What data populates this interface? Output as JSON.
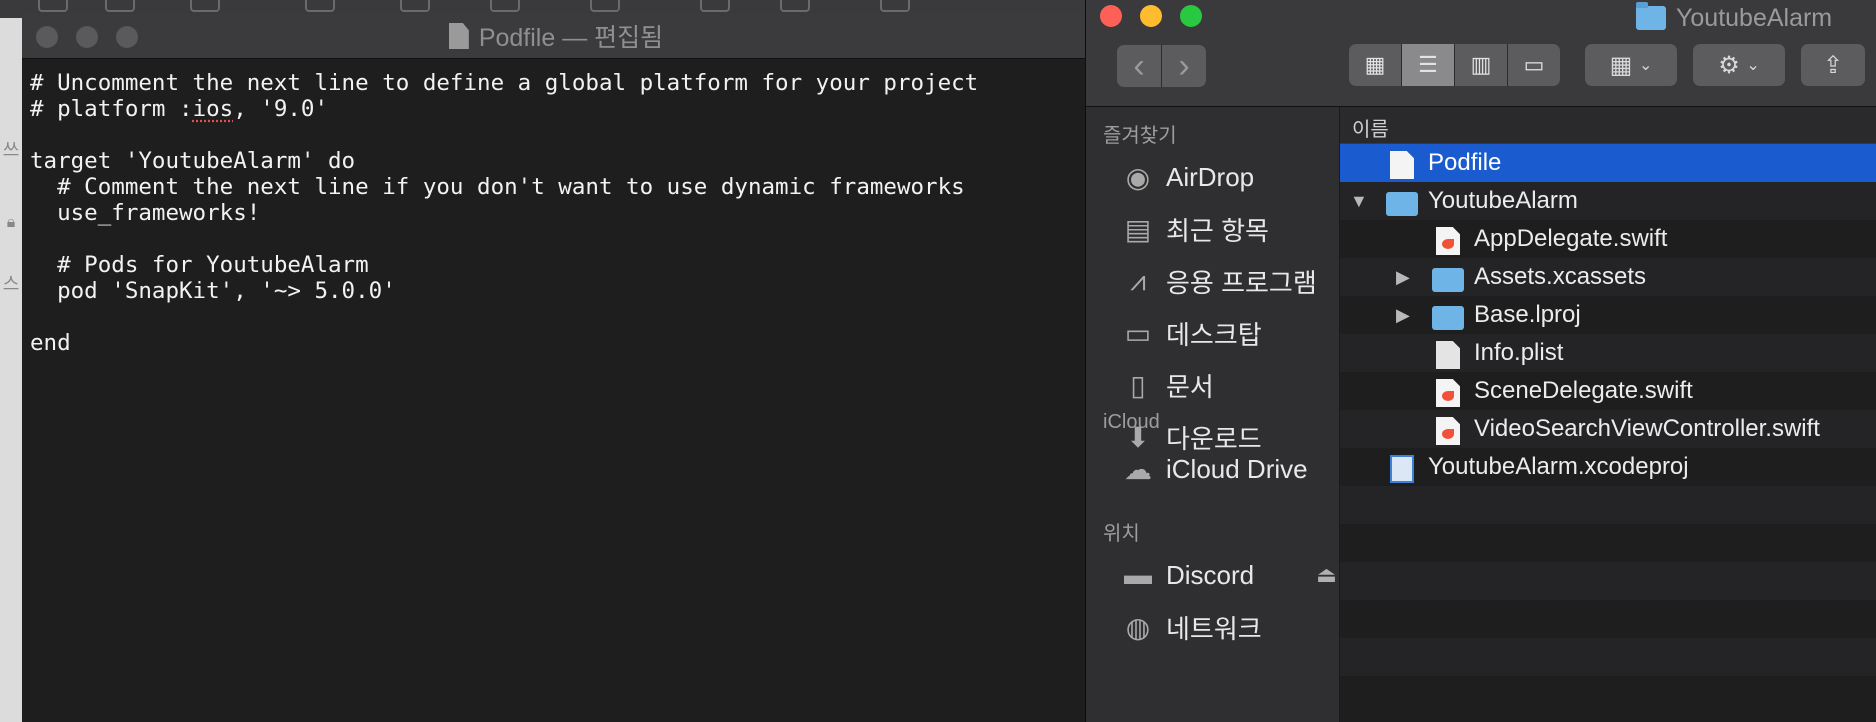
{
  "editor": {
    "title": "Podfile — 편집됨",
    "lines": [
      "# Uncomment the next line to define a global platform for your project",
      "# platform :ios, '9.0'",
      "",
      "target 'YoutubeAlarm' do",
      "  # Comment the next line if you don't want to use dynamic frameworks",
      "  use_frameworks!",
      "",
      "  # Pods for YoutubeAlarm",
      "  pod 'SnapKit', '~> 5.0.0'",
      "",
      "end"
    ],
    "misspelled_word": "ios"
  },
  "background_app": {
    "side_chars": [
      "쓰",
      "스"
    ]
  },
  "finder": {
    "title": "YoutubeAlarm",
    "toolbar": {
      "back_icon": "‹",
      "forward_icon": "›",
      "view_modes": [
        "icon-view",
        "list-view",
        "column-view",
        "gallery-view"
      ],
      "active_view": "list-view"
    },
    "sidebar": {
      "favorites_header": "즐겨찾기",
      "favorites": [
        {
          "label": "AirDrop",
          "icon": "airdrop-icon",
          "glyph": "◉"
        },
        {
          "label": "최근 항목",
          "icon": "recents-icon",
          "glyph": "▤"
        },
        {
          "label": "응용 프로그램",
          "icon": "applications-icon",
          "glyph": "⩘"
        },
        {
          "label": "데스크탑",
          "icon": "desktop-icon",
          "glyph": "▭"
        },
        {
          "label": "문서",
          "icon": "documents-icon",
          "glyph": "▯"
        },
        {
          "label": "다운로드",
          "icon": "downloads-icon",
          "glyph": "⬇"
        }
      ],
      "icloud_header": "iCloud",
      "icloud": [
        {
          "label": "iCloud Drive",
          "icon": "cloud-icon",
          "glyph": "☁"
        }
      ],
      "locations_header": "위치",
      "locations": [
        {
          "label": "Discord",
          "icon": "disk-icon",
          "glyph": "▬"
        },
        {
          "label": "네트워크",
          "icon": "network-icon",
          "glyph": "◍"
        }
      ]
    },
    "list": {
      "column_header": "이름",
      "items": [
        {
          "name": "Podfile",
          "type": "doc",
          "level": 0,
          "disclosure": "",
          "selected": true
        },
        {
          "name": "YoutubeAlarm",
          "type": "folder",
          "level": 0,
          "disclosure": "▼",
          "selected": false
        },
        {
          "name": "AppDelegate.swift",
          "type": "swift",
          "level": 1,
          "disclosure": "",
          "selected": false
        },
        {
          "name": "Assets.xcassets",
          "type": "folder",
          "level": 1,
          "disclosure": "▶",
          "selected": false
        },
        {
          "name": "Base.lproj",
          "type": "folder",
          "level": 1,
          "disclosure": "▶",
          "selected": false
        },
        {
          "name": "Info.plist",
          "type": "plist",
          "level": 1,
          "disclosure": "",
          "selected": false
        },
        {
          "name": "SceneDelegate.swift",
          "type": "swift",
          "level": 1,
          "disclosure": "",
          "selected": false
        },
        {
          "name": "VideoSearchViewController.swift",
          "type": "swift",
          "level": 1,
          "disclosure": "",
          "selected": false
        },
        {
          "name": "YoutubeAlarm.xcodeproj",
          "type": "xcode",
          "level": 0,
          "disclosure": "",
          "selected": false
        }
      ]
    },
    "colors": {
      "selection": "#1b5bd0",
      "folder": "#6fb4e6",
      "swift": "#f05138"
    }
  }
}
